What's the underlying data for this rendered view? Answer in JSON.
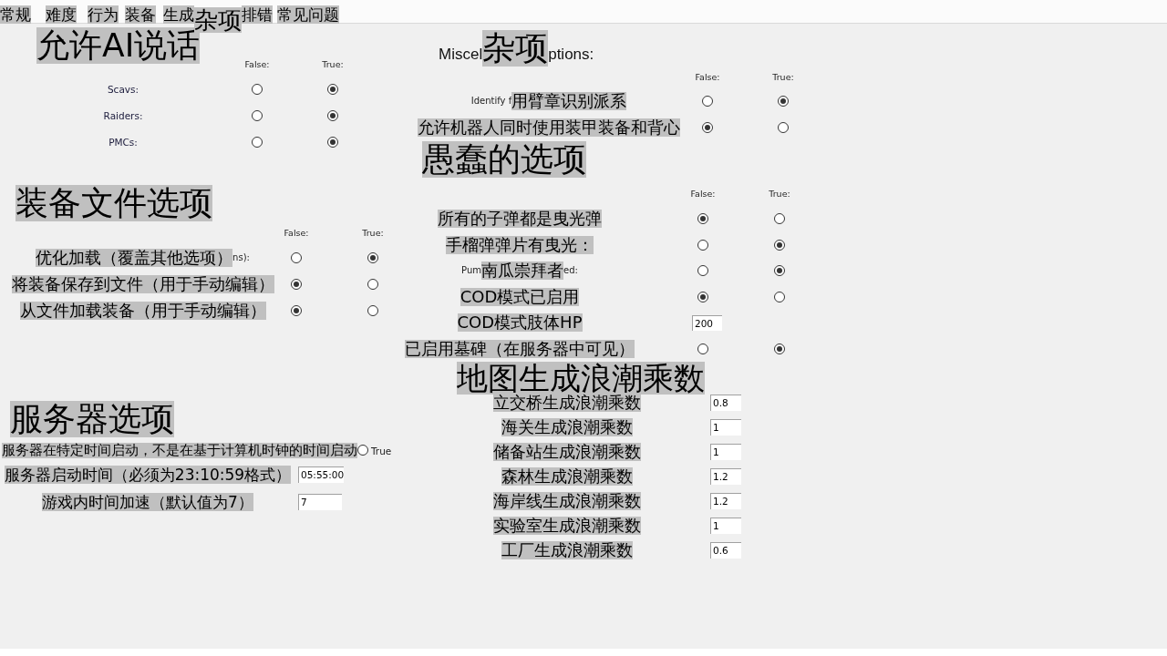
{
  "tabs": [
    {
      "label": "常规",
      "selected": false
    },
    {
      "label": "难度",
      "selected": false
    },
    {
      "label": "行为",
      "selected": false
    },
    {
      "label": "装备",
      "selected": false
    },
    {
      "label": "生成",
      "selected": false
    },
    {
      "label": "杂项",
      "selected": true
    },
    {
      "label": "排错",
      "selected": false
    },
    {
      "label": "常见问题",
      "selected": false
    }
  ],
  "left": [
    {
      "heading": "允许AI说话",
      "columns": [
        "False:",
        "True:"
      ],
      "rows": [
        {
          "kind": "toggle",
          "label": "Scavs:",
          "highlighted": false,
          "choices": [
            {
              "selected": false
            },
            {
              "selected": true
            }
          ]
        },
        {
          "kind": "toggle",
          "label": "Raiders:",
          "highlighted": false,
          "choices": [
            {
              "selected": false
            },
            {
              "selected": true
            }
          ]
        },
        {
          "kind": "toggle",
          "label": "PMCs:",
          "highlighted": false,
          "choices": [
            {
              "selected": false
            },
            {
              "selected": true
            }
          ]
        }
      ]
    },
    {
      "heading": "装备文件选项",
      "columns": [
        "False:",
        "True:"
      ],
      "rows": [
        {
          "kind": "toggle",
          "label": "优化加载（覆盖其他选项）",
          "suffix": "ns):",
          "highlighted": true,
          "choices": [
            {
              "selected": false
            },
            {
              "selected": true
            }
          ]
        },
        {
          "kind": "toggle",
          "label": "将装备保存到文件（用于手动编辑）",
          "highlighted": true,
          "choices": [
            {
              "selected": true
            },
            {
              "selected": false
            }
          ]
        },
        {
          "kind": "toggle",
          "label": "从文件加载装备（用于手动编辑）",
          "highlighted": true,
          "choices": [
            {
              "selected": true
            },
            {
              "selected": false
            }
          ]
        }
      ]
    },
    {
      "heading": "服务器选项",
      "rows": [
        {
          "kind": "check",
          "label": "服务器在特定时间启动，不是在基于计算机时钟的时间启动",
          "highlighted": true,
          "checked": false,
          "option": "True"
        },
        {
          "kind": "input",
          "label": "服务器启动时间（必须为23:10:59格式）",
          "highlighted": true,
          "value": "05:55:00"
        },
        {
          "kind": "input",
          "label": "游戏内时间加速（默认值为7）",
          "highlighted": true,
          "value": "7"
        }
      ]
    }
  ],
  "right": [
    {
      "heading_prefix": "Miscel",
      "heading": "杂项",
      "heading_suffix": "ptions:",
      "columns": [
        "False:",
        "True:"
      ],
      "rows": [
        {
          "kind": "toggle",
          "prefix": "Identify f",
          "label": "用臂章识别派系",
          "highlighted": true,
          "choices": [
            {
              "selected": false
            },
            {
              "selected": true
            }
          ]
        },
        {
          "kind": "toggle",
          "label": "允许机器人同时使用装甲装备和背心",
          "highlighted": true,
          "choices": [
            {
              "selected": true
            },
            {
              "selected": false
            }
          ]
        }
      ]
    },
    {
      "heading": "愚蠢的选项",
      "columns": [
        "False:",
        "True:"
      ],
      "rows": [
        {
          "kind": "toggle",
          "label": "所有的子弹都是曳光弹",
          "highlighted": true,
          "choices": [
            {
              "selected": true
            },
            {
              "selected": false
            }
          ]
        },
        {
          "kind": "toggle",
          "label": "手榴弹弹片有曳光：",
          "highlighted": true,
          "choices": [
            {
              "selected": false
            },
            {
              "selected": true
            }
          ]
        },
        {
          "kind": "toggle",
          "prefix": "Pum",
          "label": "南瓜崇拜者",
          "suffix": "ed:",
          "highlighted": true,
          "choices": [
            {
              "selected": false
            },
            {
              "selected": true
            }
          ]
        },
        {
          "kind": "toggle",
          "label": "COD模式已启用",
          "highlighted": true,
          "choices": [
            {
              "selected": true
            },
            {
              "selected": false
            }
          ]
        },
        {
          "kind": "input",
          "label": "COD模式肢体HP",
          "highlighted": true,
          "value": "200"
        },
        {
          "kind": "toggle",
          "label": "已启用墓碑（在服务器中可见）",
          "highlighted": true,
          "choices": [
            {
              "selected": false
            },
            {
              "selected": true
            }
          ]
        }
      ]
    },
    {
      "heading": "地图生成浪潮乘数",
      "rows": [
        {
          "kind": "input",
          "label": "立交桥生成浪潮乘数",
          "highlighted": true,
          "value": "0.8"
        },
        {
          "kind": "input",
          "label": "海关生成浪潮乘数",
          "highlighted": true,
          "value": "1"
        },
        {
          "kind": "input",
          "label": "储备站生成浪潮乘数",
          "highlighted": true,
          "value": "1"
        },
        {
          "kind": "input",
          "label": "森林生成浪潮乘数",
          "highlighted": true,
          "value": "1.2"
        },
        {
          "kind": "input",
          "label": "海岸线生成浪潮乘数",
          "highlighted": true,
          "value": "1.2"
        },
        {
          "kind": "input",
          "label": "实验室生成浪潮乘数",
          "highlighted": true,
          "value": "1"
        },
        {
          "kind": "input",
          "label": "工厂生成浪潮乘数",
          "highlighted": true,
          "value": "0.6"
        }
      ]
    }
  ]
}
